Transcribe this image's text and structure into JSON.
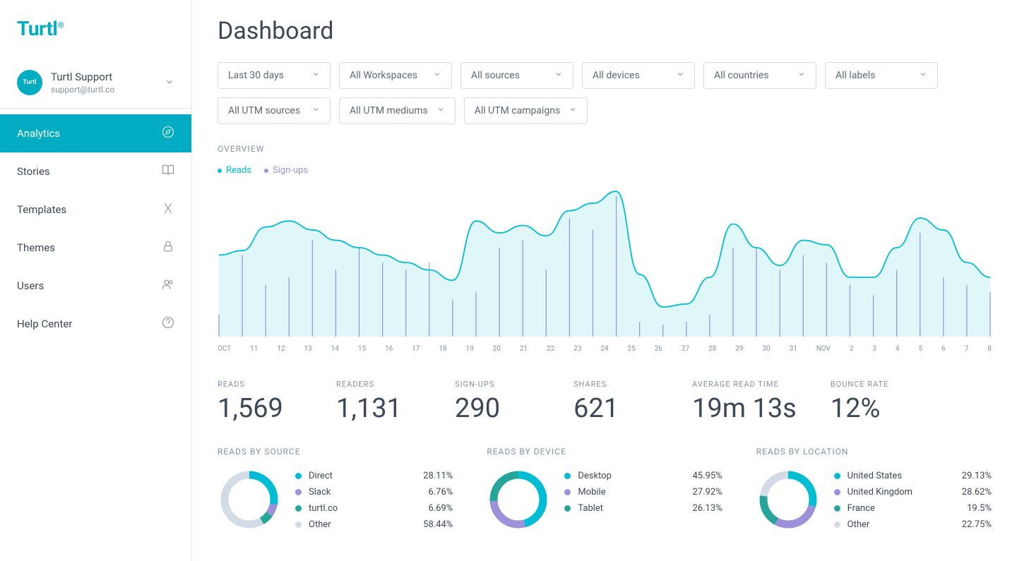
{
  "brand": "Turtl",
  "user": {
    "name": "Turtl Support",
    "email": "support@turtl.co",
    "avatar_text": "Turtl"
  },
  "nav": [
    {
      "label": "Analytics",
      "active": true,
      "icon": "compass-icon"
    },
    {
      "label": "Stories",
      "active": false,
      "icon": "book-icon"
    },
    {
      "label": "Templates",
      "active": false,
      "icon": "tools-icon"
    },
    {
      "label": "Themes",
      "active": false,
      "icon": "lock-icon"
    },
    {
      "label": "Users",
      "active": false,
      "icon": "people-icon"
    },
    {
      "label": "Help Center",
      "active": false,
      "icon": "help-icon"
    }
  ],
  "page_title": "Dashboard",
  "filters": [
    "Last 30 days",
    "All Workspaces",
    "All sources",
    "All devices",
    "All countries",
    "All labels",
    "All UTM sources",
    "All UTM mediums",
    "All UTM campaigns"
  ],
  "overview_label": "OVERVIEW",
  "legend": [
    {
      "label": "Reads",
      "color": "#00bcd4"
    },
    {
      "label": "Sign-ups",
      "color": "#9e91d9"
    }
  ],
  "chart_data": {
    "type": "line",
    "categories": [
      "OCT",
      "11",
      "12",
      "13",
      "14",
      "15",
      "16",
      "17",
      "18",
      "19",
      "20",
      "21",
      "22",
      "23",
      "24",
      "25",
      "26",
      "27",
      "28",
      "29",
      "30",
      "31",
      "NOV",
      "2",
      "3",
      "4",
      "5",
      "6",
      "7",
      "8"
    ],
    "title": "",
    "xlabel": "",
    "ylabel": "",
    "ylim": [
      0,
      100
    ],
    "series": [
      {
        "name": "Reads",
        "color": "#00bcd4",
        "type": "area",
        "values": [
          55,
          58,
          74,
          78,
          72,
          65,
          60,
          55,
          50,
          45,
          38,
          78,
          70,
          75,
          68,
          85,
          90,
          98,
          42,
          20,
          22,
          40,
          76,
          60,
          48,
          65,
          62,
          40,
          40,
          60,
          80,
          72,
          50,
          40
        ]
      },
      {
        "name": "Sign-ups",
        "color": "#9e91d9",
        "type": "bar",
        "values": [
          15,
          55,
          35,
          40,
          65,
          45,
          60,
          50,
          45,
          50,
          25,
          30,
          60,
          65,
          45,
          80,
          72,
          95,
          10,
          8,
          10,
          15,
          60,
          60,
          45,
          55,
          50,
          35,
          28,
          45,
          70,
          40,
          35,
          30
        ]
      }
    ]
  },
  "metrics": [
    {
      "label": "READS",
      "value": "1,569"
    },
    {
      "label": "READERS",
      "value": "1,131"
    },
    {
      "label": "SIGN-UPS",
      "value": "290"
    },
    {
      "label": "SHARES",
      "value": "621"
    },
    {
      "label": "AVERAGE READ TIME",
      "value": "19m 13s"
    },
    {
      "label": "BOUNCE RATE",
      "value": "12%"
    }
  ],
  "donuts": [
    {
      "title": "READS BY SOURCE",
      "items": [
        {
          "label": "Direct",
          "value": "28.11%",
          "color": "#00bcd4",
          "pct": 28.11
        },
        {
          "label": "Slack",
          "value": "6.76%",
          "color": "#9e91d9",
          "pct": 6.76
        },
        {
          "label": "turtl.co",
          "value": "6.69%",
          "color": "#26a69a",
          "pct": 6.69
        },
        {
          "label": "Other",
          "value": "58.44%",
          "color": "#d3dce6",
          "pct": 58.44
        }
      ]
    },
    {
      "title": "READS BY DEVICE",
      "items": [
        {
          "label": "Desktop",
          "value": "45.95%",
          "color": "#00bcd4",
          "pct": 45.95
        },
        {
          "label": "Mobile",
          "value": "27.92%",
          "color": "#9e91d9",
          "pct": 27.92
        },
        {
          "label": "Tablet",
          "value": "26.13%",
          "color": "#26a69a",
          "pct": 26.13
        }
      ]
    },
    {
      "title": "READS BY LOCATION",
      "items": [
        {
          "label": "United States",
          "value": "29.13%",
          "color": "#00bcd4",
          "pct": 29.13
        },
        {
          "label": "United Kingdom",
          "value": "28.62%",
          "color": "#9e91d9",
          "pct": 28.62
        },
        {
          "label": "France",
          "value": "19.5%",
          "color": "#26a69a",
          "pct": 19.5
        },
        {
          "label": "Other",
          "value": "22.75%",
          "color": "#d3dce6",
          "pct": 22.75
        }
      ]
    }
  ]
}
